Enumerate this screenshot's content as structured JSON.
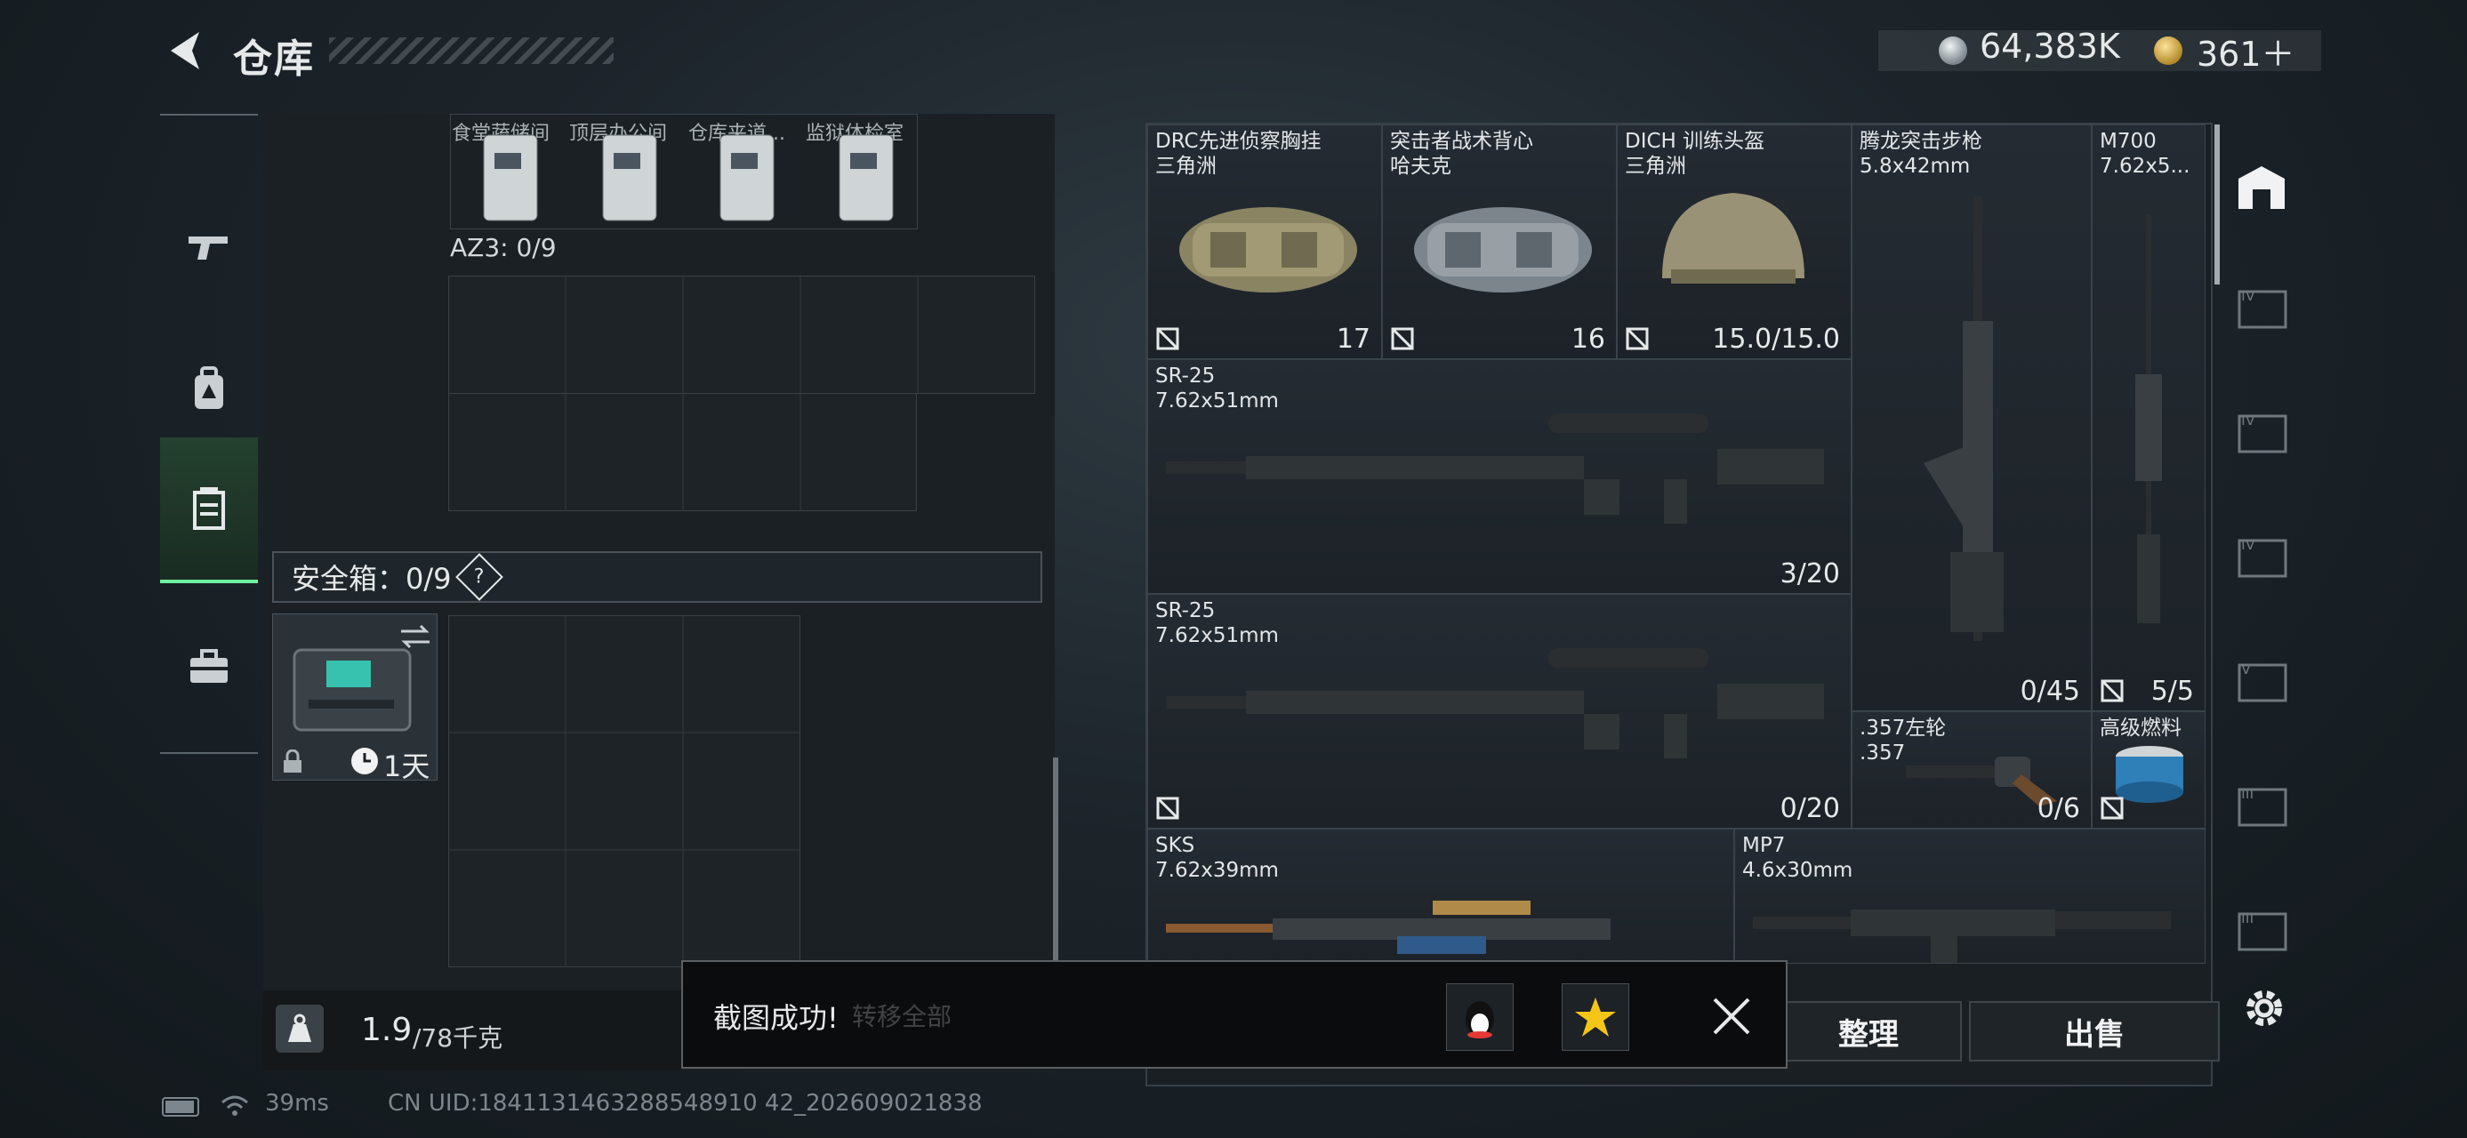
{
  "header": {
    "title": "仓库",
    "silver_amount": "64,383K",
    "gold_amount": "361＋"
  },
  "left_panel": {
    "shelf_labels": [
      "食堂蔬储间",
      "顶层办公间",
      "仓库夹道...",
      "监狱体检室"
    ],
    "az3_label": "AZ3: 0/9",
    "safe_box_label": "安全箱：0/9",
    "safe_box_help": "?",
    "safe_box_duration": "1天",
    "weight_current": "1.9",
    "weight_max": "/78千克"
  },
  "items": [
    {
      "name": "DRC先进侦察胸挂",
      "sub": "三角洲",
      "count": "17"
    },
    {
      "name": "突击者战术背心",
      "sub": "哈夫克",
      "count": "16"
    },
    {
      "name": "DICH 训练头盔",
      "sub": "三角洲",
      "count": "15.0/15.0"
    },
    {
      "name": "腾龙突击步枪",
      "sub": "5.8x42mm",
      "count": "0/45"
    },
    {
      "name": "M700",
      "sub": "7.62x5...",
      "count": "5/5"
    },
    {
      "name": "SR-25",
      "sub": "7.62x51mm",
      "count": "3/20"
    },
    {
      "name": "SR-25",
      "sub": "7.62x51mm",
      "count": "0/20"
    },
    {
      "name": ".357左轮",
      "sub": ".357",
      "count": "0/6"
    },
    {
      "name": "高级燃料",
      "sub": "",
      "count": ""
    },
    {
      "name": "SKS",
      "sub": "7.62x39mm",
      "count": ""
    },
    {
      "name": "MP7",
      "sub": "4.6x30mm",
      "count": ""
    }
  ],
  "toast": {
    "message": "截图成功!",
    "behind_label": "转移全部"
  },
  "buttons": {
    "sort": "整理",
    "sell": "出售"
  },
  "status": {
    "ping": "39ms",
    "uid": "CN UID:1841131463288548910 42_202609021838"
  },
  "icons": {
    "back": "back-arrow-icon",
    "tabs": [
      "gun-icon",
      "backpack-icon",
      "locker-icon",
      "briefcase-icon"
    ],
    "settings": "gear-icon"
  },
  "colors": {
    "accent_green": "#6ef0a0",
    "panel_bg": "#1a1f24"
  }
}
